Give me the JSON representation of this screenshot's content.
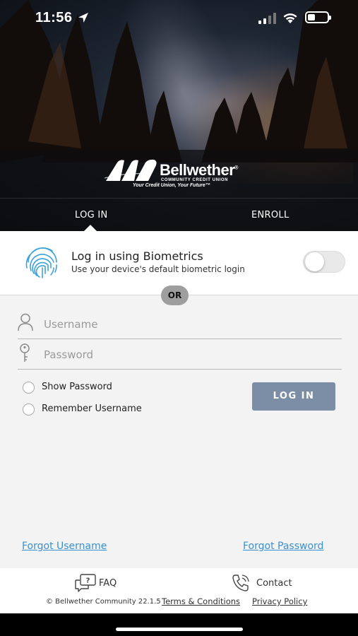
{
  "status_bar": {
    "time": "11:56",
    "icons": [
      "location-arrow-icon",
      "cellular-signal-icon",
      "wifi-icon",
      "battery-icon"
    ]
  },
  "brand": {
    "name": "Bellwether",
    "registered": "®",
    "subtitle": "COMMUNITY CREDIT UNION",
    "tagline": "Your Credit Union, Your Future™"
  },
  "tabs": [
    {
      "label": "LOG IN",
      "active": true
    },
    {
      "label": "ENROLL",
      "active": false
    }
  ],
  "biometrics": {
    "title": "Log in using Biometrics",
    "description": "Use your device's default biometric login",
    "toggle_on": false
  },
  "divider": {
    "label": "OR"
  },
  "form": {
    "username": {
      "placeholder": "Username",
      "value": ""
    },
    "password": {
      "placeholder": "Password",
      "value": ""
    },
    "show_password": {
      "label": "Show Password",
      "checked": false
    },
    "remember_username": {
      "label": "Remember Username",
      "checked": false
    },
    "submit_label": "LOG IN"
  },
  "links": {
    "forgot_username": "Forgot Username",
    "forgot_password": "Forgot Password"
  },
  "footer": {
    "faq": "FAQ",
    "contact": "Contact",
    "copyright": "© Bellwether Community 22.1.5",
    "terms": "Terms & Conditions",
    "privacy": "Privacy Policy"
  },
  "colors": {
    "accent_link": "#3b8fd0",
    "login_button": "#7c8ea6",
    "form_background": "#f3f3f3",
    "fingerprint": "#3aa3d9"
  }
}
